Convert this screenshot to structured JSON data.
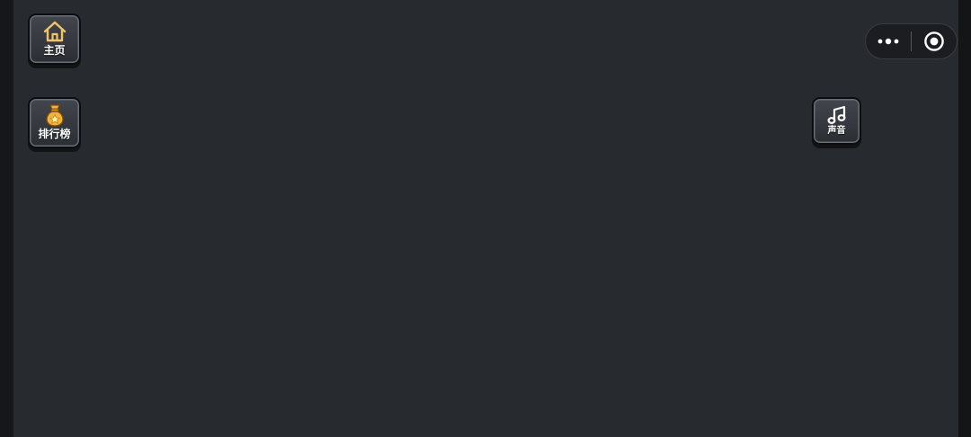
{
  "buttons": {
    "home": {
      "label": "主页",
      "icon": "home-icon"
    },
    "rank": {
      "label": "排行榜",
      "icon": "money-bag-star-icon"
    },
    "sound": {
      "label": "声音",
      "icon": "music-note-icon"
    }
  },
  "capsule": {
    "more_icon": "more-dots-icon",
    "close_icon": "target-circle-icon"
  },
  "colors": {
    "background": "#272a2f",
    "frame": "#16171a",
    "button": "#35383d",
    "accent_gold": "#f2b43a",
    "label": "#ffffff"
  }
}
